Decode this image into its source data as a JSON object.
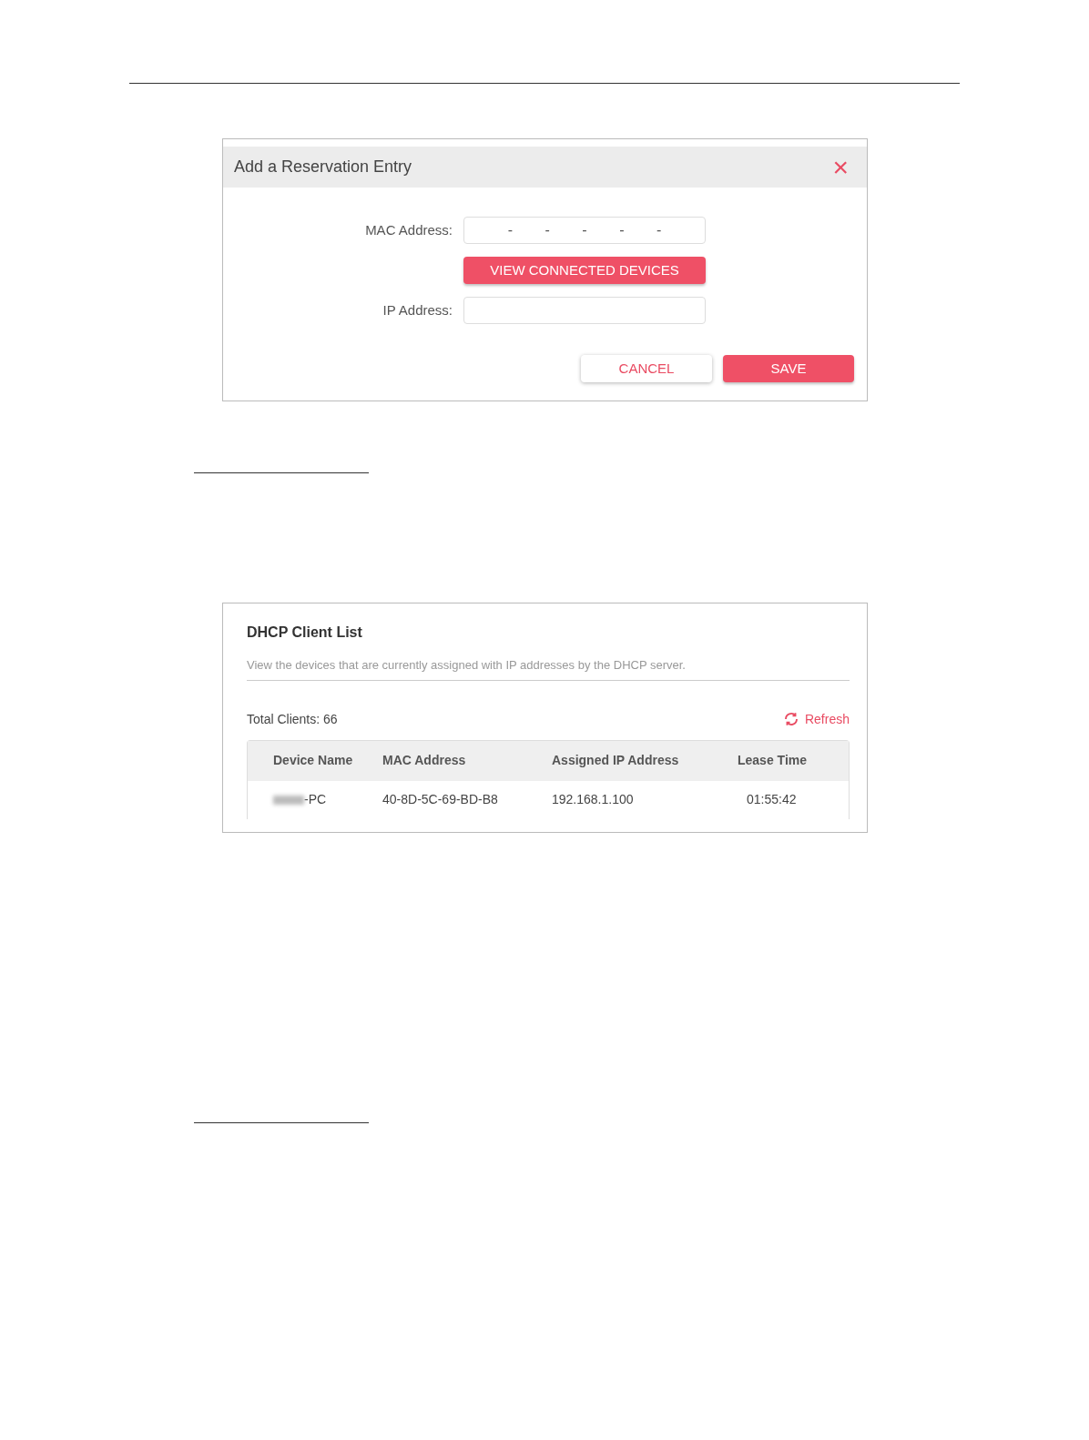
{
  "dialog": {
    "title": "Add a Reservation Entry",
    "close": "×",
    "mac": {
      "label": "MAC Address:",
      "separators": [
        "-",
        "-",
        "-",
        "-",
        "-"
      ]
    },
    "view_button": "VIEW CONNECTED DEVICES",
    "ip": {
      "label": "IP Address:"
    },
    "buttons": [
      {
        "label": "CANCEL",
        "kind": "secondary"
      },
      {
        "label": "SAVE",
        "kind": "primary"
      }
    ]
  },
  "client_list": {
    "title": "DHCP Client List",
    "description": "View the devices that are currently assigned with IP addresses by the DHCP server.",
    "total": "Total Clients: 66",
    "refresh": "Refresh",
    "columns": [
      "Device Name",
      "MAC Address",
      "Assigned IP Address",
      "Lease Time"
    ],
    "rows": [
      {
        "device": "-PC",
        "redacted": true,
        "mac": "40-8D-5C-69-BD-B8",
        "ip": "192.168.1.100",
        "lease": "01:55:42"
      }
    ]
  }
}
